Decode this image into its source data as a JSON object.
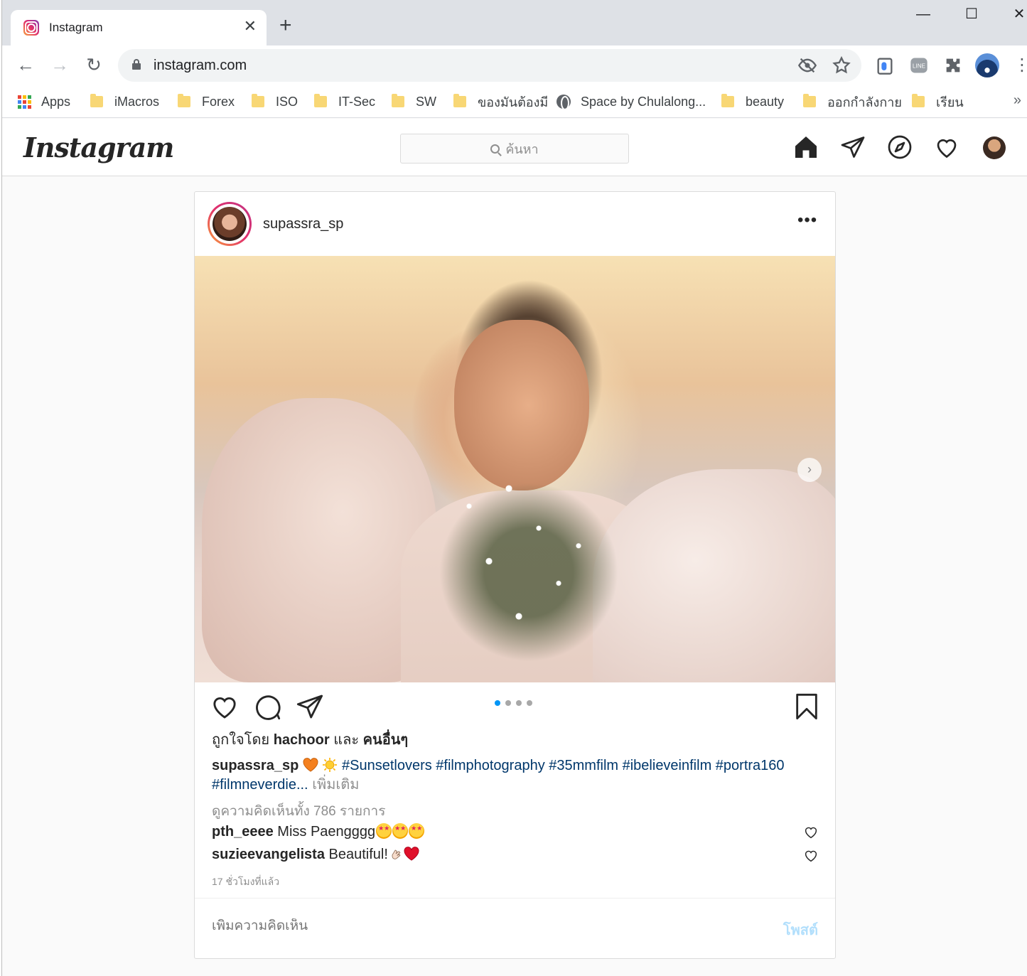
{
  "browser": {
    "tab_title": "Instagram",
    "tab_close": "✕",
    "new_tab": "+",
    "window_controls": {
      "minimize": "—",
      "maximize": "☐",
      "close": "✕"
    },
    "url": "instagram.com",
    "bookmarks": [
      {
        "label": "Apps",
        "icon": "apps-grid-icon"
      },
      {
        "label": "iMacros",
        "icon": "folder-icon"
      },
      {
        "label": "Forex",
        "icon": "folder-icon"
      },
      {
        "label": "ISO",
        "icon": "folder-icon"
      },
      {
        "label": "IT-Sec",
        "icon": "folder-icon"
      },
      {
        "label": "SW",
        "icon": "folder-icon"
      },
      {
        "label": "ของมันต้องมี",
        "icon": "folder-icon"
      },
      {
        "label": "Space by Chulalong...",
        "icon": "globe-icon"
      },
      {
        "label": "beauty",
        "icon": "folder-icon"
      },
      {
        "label": "ออกกำลังกาย",
        "icon": "folder-icon"
      },
      {
        "label": "เรียน",
        "icon": "folder-icon"
      }
    ],
    "bookmarks_more": "»"
  },
  "instagram": {
    "logo": "Instagram",
    "search_placeholder": "ค้นหา"
  },
  "post": {
    "username": "supassra_sp",
    "more": "•••",
    "carousel": {
      "count": 4,
      "active": 0
    },
    "liked_by_prefix": "ถูกใจโดย",
    "liked_by_user": "hachoor",
    "liked_by_and": "และ",
    "liked_by_others": "คนอื่นๆ",
    "caption_user": "supassra_sp",
    "caption_tags": "#Sunsetlovers #filmphotography #35mmfilm #ibelieveinfilm #portra160 #filmneverdie...",
    "caption_more": "เพิ่มเติม",
    "view_comments": "ดูความคิดเห็นทั้ง 786 รายการ",
    "comments": [
      {
        "user": "pth_eeee",
        "text": "Miss Paengggg"
      },
      {
        "user": "suzieevangelista",
        "text": "Beautiful!"
      }
    ],
    "timestamp": "17 ชั่วโมงที่แล้ว",
    "add_comment_placeholder": "เพิ่มความคิดเห็น",
    "post_button": "โพสต์"
  },
  "colors": {
    "accent_blue": "#0095f6",
    "hashtag": "#00376b",
    "post_button_disabled": "#b2dffc"
  }
}
